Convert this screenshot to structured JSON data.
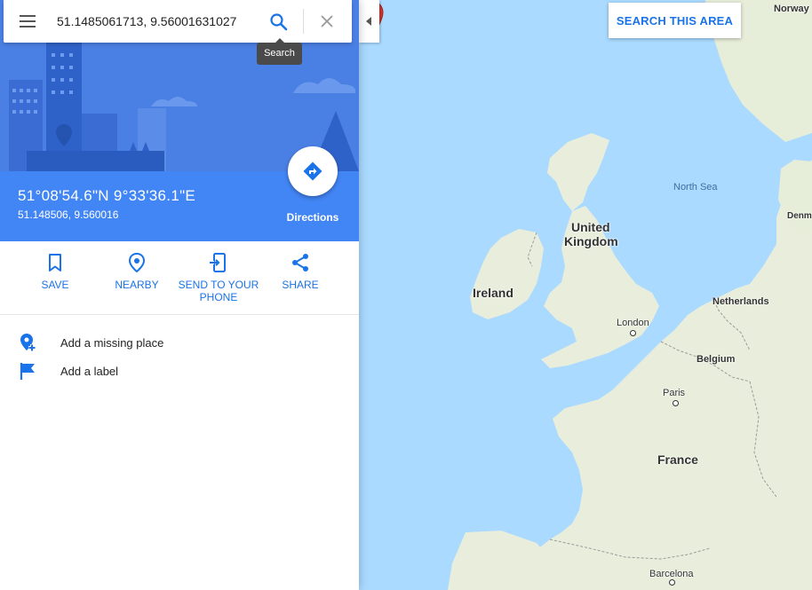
{
  "search": {
    "value": "51.1485061713, 9.56001631027",
    "tooltip": "Search"
  },
  "place": {
    "coord_dms": "51°08'54.6\"N 9°33'36.1\"E",
    "coord_decimal": "51.148506, 9.560016",
    "directions_label": "Directions"
  },
  "actions": [
    {
      "label": "SAVE",
      "icon": "bookmark-icon"
    },
    {
      "label": "NEARBY",
      "icon": "nearby-icon"
    },
    {
      "label": "SEND TO YOUR PHONE",
      "icon": "send-to-phone-icon"
    },
    {
      "label": "SHARE",
      "icon": "share-icon"
    }
  ],
  "links": [
    {
      "label": "Add a missing place",
      "icon": "add-location-icon"
    },
    {
      "label": "Add a label",
      "icon": "flag-icon"
    }
  ],
  "map": {
    "search_area_label": "SEARCH THIS AREA",
    "labels": {
      "norway": "Norway",
      "north_sea": "North Sea",
      "denmark": "Denm",
      "united_kingdom_1": "United",
      "united_kingdom_2": "Kingdom",
      "ireland": "Ireland",
      "netherlands": "Netherlands",
      "london": "London",
      "belgium": "Belgium",
      "paris": "Paris",
      "france": "France",
      "barcelona": "Barcelona"
    }
  },
  "colors": {
    "accent": "#1a73e8",
    "panel_header": "#4285f4",
    "water": "#aadaff",
    "land": "#e8eedb",
    "marker": "#db3236"
  }
}
